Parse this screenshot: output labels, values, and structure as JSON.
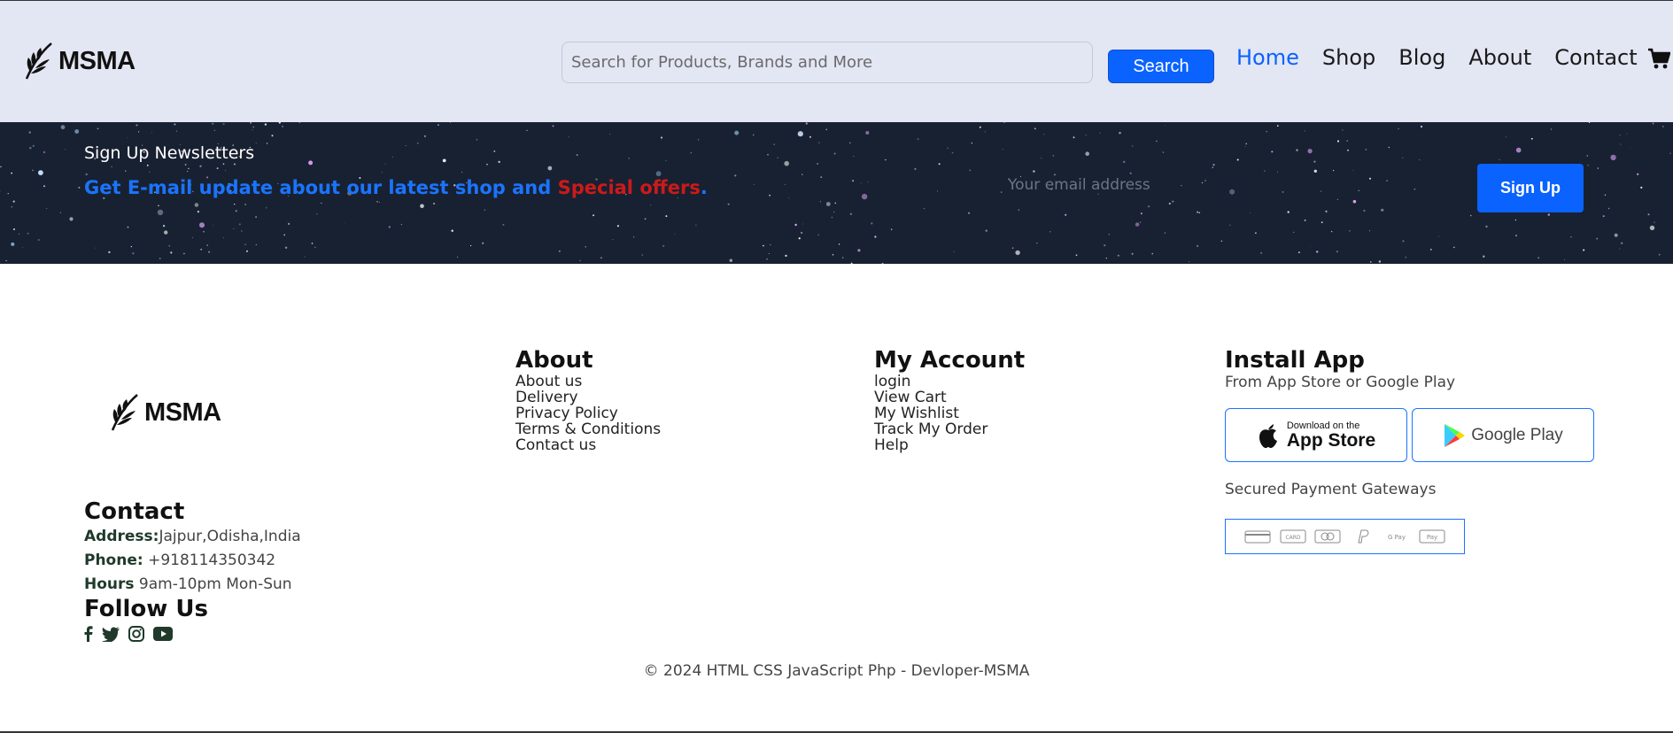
{
  "header": {
    "brand": "MSMA",
    "search": {
      "placeholder": "Search for Products, Brands and More",
      "button_label": "Search"
    },
    "nav": [
      {
        "label": "Home",
        "active": true
      },
      {
        "label": "Shop"
      },
      {
        "label": "Blog"
      },
      {
        "label": "About"
      },
      {
        "label": "Contact"
      }
    ],
    "cart_icon": "cart-icon"
  },
  "newsletter": {
    "title": "Sign Up Newsletters",
    "subtitle_blue": "Get E-mail update about our latest shop and ",
    "subtitle_red": "Special offers",
    "subtitle_end": ".",
    "email_placeholder": "Your email address",
    "button_label": "Sign Up"
  },
  "footer": {
    "brand": "MSMA",
    "about": {
      "heading": "About",
      "links": [
        "About us",
        "Delivery",
        "Privacy Policy",
        "Terms & Conditions",
        "Contact us"
      ]
    },
    "account": {
      "heading": "My Account",
      "links": [
        "login",
        "View Cart",
        "My Wishlist",
        "Track My Order",
        "Help"
      ]
    },
    "install": {
      "heading": "Install App",
      "subtitle": "From App Store or Google Play",
      "app_store_small": "Download on the",
      "app_store_big": "App Store",
      "google_play": "Google Play",
      "payment_label": "Secured Payment Gateways",
      "payment_icons": [
        "card-icon",
        "mastercard-icon",
        "visa-icon",
        "paypal-icon",
        "gpay-icon",
        "maestro-icon"
      ]
    },
    "contact": {
      "heading": "Contact",
      "address_label": "Address:",
      "address": "Jajpur,Odisha,India",
      "phone_label": "Phone:",
      "phone": " +918114350342",
      "hours_label": "Hours",
      "hours": " 9am-10pm Mon-Sun"
    },
    "follow": {
      "heading": "Follow Us",
      "icons": [
        "facebook-icon",
        "twitter-icon",
        "instagram-icon",
        "youtube-icon"
      ]
    },
    "copyright": "© 2024 HTML CSS JavaScript Php - Devloper-MSMA"
  },
  "colors": {
    "accent": "#0a63ff",
    "header_bg": "#e3e6f3",
    "offer_red": "#cc1a1a"
  }
}
